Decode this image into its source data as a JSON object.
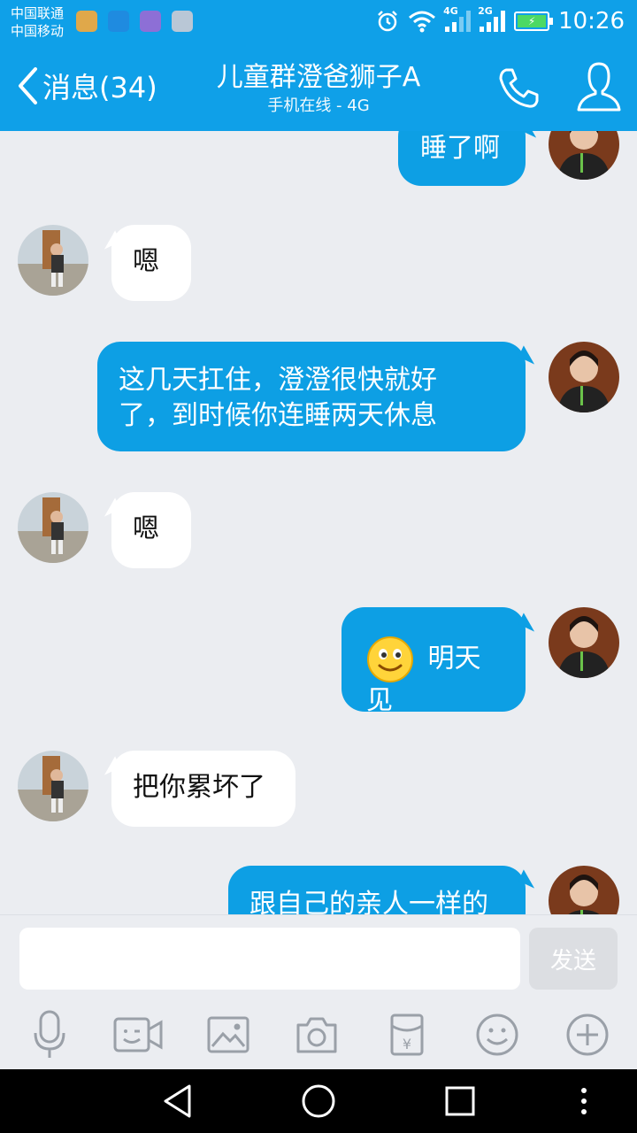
{
  "status_bar": {
    "carrier_1": "中国联通",
    "carrier_2": "中国移动",
    "network_1": "4G",
    "network_2": "2G",
    "time": "10:26"
  },
  "header": {
    "back_label": "消息(34)",
    "title": "儿童群澄爸狮子A",
    "subtitle": "手机在线 - 4G"
  },
  "messages": [
    {
      "direction": "out",
      "text": "睡了啊"
    },
    {
      "direction": "in",
      "text": "嗯"
    },
    {
      "direction": "out",
      "text_line1": "这几天扛住，澄澄很快就好",
      "text_line2": "了，到时候你连睡两天休息"
    },
    {
      "direction": "in",
      "text": "嗯"
    },
    {
      "direction": "out",
      "emoji": "smiley-emoji",
      "text": "明天见"
    },
    {
      "direction": "in",
      "text": "把你累坏了"
    },
    {
      "direction": "out",
      "text": "跟自己的亲人一样的"
    }
  ],
  "input": {
    "value": "",
    "send_label": "发送"
  },
  "toolbar": [
    "microphone-icon",
    "video-call-icon",
    "image-icon",
    "camera-icon",
    "red-packet-icon",
    "emoji-icon",
    "plus-icon"
  ],
  "colors": {
    "accent": "#0fa0e8",
    "outgoing_bubble": "#0d9fe4",
    "incoming_bubble": "#ffffff",
    "background": "#ebedf1"
  }
}
